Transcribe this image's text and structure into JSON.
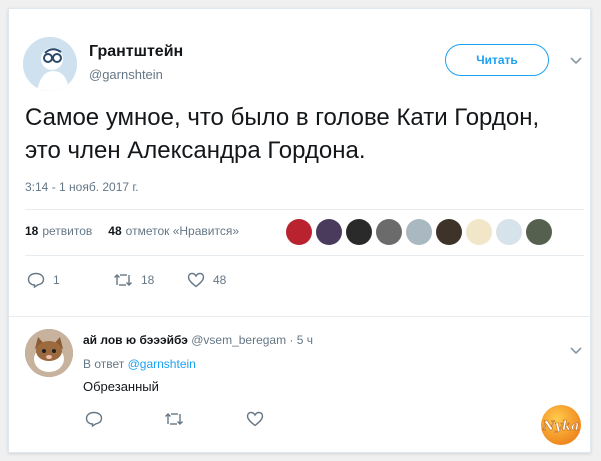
{
  "tweet": {
    "author_name": "Грантштейн",
    "author_handle": "@garnshtein",
    "follow_label": "Читать",
    "text": "Самое умное, что было в голове Кати Гордон, это член Александра Гордона.",
    "timestamp": "3:14 - 1 нояб. 2017 г.",
    "retweets_count": "18",
    "retweets_label": "ретвитов",
    "likes_count": "48",
    "likes_label": "отметок «Нравится»",
    "actions": {
      "reply_count": "1",
      "retweet_count": "18",
      "like_count": "48"
    }
  },
  "reply": {
    "author_name": "ай лов ю бэээйбэ",
    "author_handle": "@vsem_beregam",
    "time": "· 5 ч",
    "reply_prefix": "В ответ",
    "reply_to_handle": "@garnshtein",
    "text": "Обрезанный"
  },
  "watermark_text": "Nyka",
  "colors": {
    "accent": "#1da1f2",
    "muted": "#657786",
    "text": "#14171a"
  }
}
